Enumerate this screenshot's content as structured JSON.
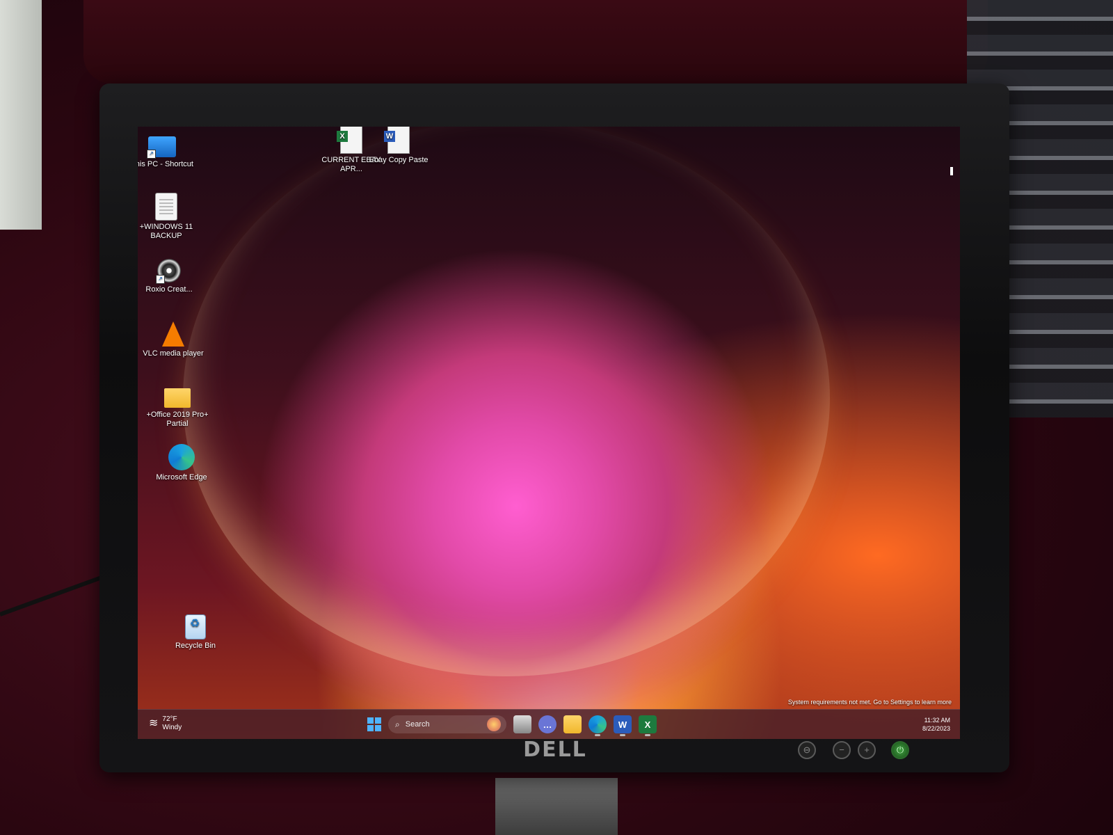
{
  "desktop": {
    "icons_left": [
      {
        "label": "This PC - Shortcut",
        "icon": "computer-icon"
      },
      {
        "label": "+WINDOWS 11 BACKUP",
        "icon": "document-icon"
      },
      {
        "label": "Roxio Creat...",
        "icon": "disc-icon"
      },
      {
        "label": "VLC media player",
        "icon": "vlc-cone-icon"
      },
      {
        "label": "+Office 2019 Pro+ Partial",
        "icon": "folder-icon"
      },
      {
        "label": "Microsoft Edge",
        "icon": "edge-icon"
      }
    ],
    "icons_top": [
      {
        "label": "CURRENT EBAY APR...",
        "icon": "excel-file-icon"
      },
      {
        "label": "Ebay Copy Paste",
        "icon": "word-file-icon"
      }
    ],
    "recycle_bin": {
      "label": "Recycle Bin",
      "icon": "recycle-bin-icon"
    },
    "watermark": "System requirements not met. Go to Settings to learn more"
  },
  "taskbar": {
    "weather": {
      "temp": "72°F",
      "condition": "Windy"
    },
    "search_label": "Search",
    "clock": {
      "time": "11:32 AM",
      "date": "8/22/2023"
    }
  },
  "monitor": {
    "brand": "DELL"
  },
  "colors": {
    "taskbar": "#46202a",
    "accent": "#4fb3ff"
  }
}
